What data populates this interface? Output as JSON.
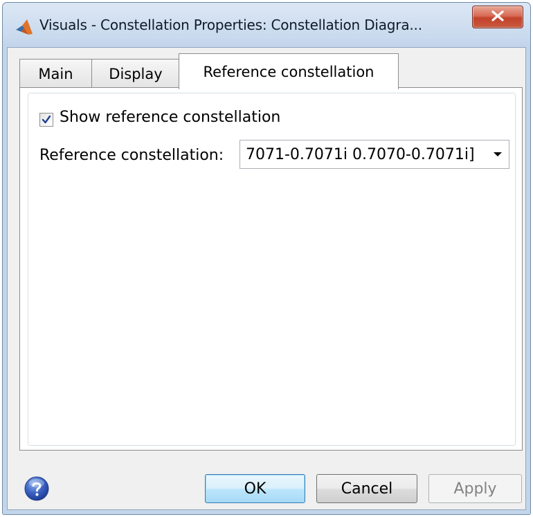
{
  "window": {
    "title": "Visuals - Constellation Properties: Constellation Diagra..."
  },
  "tabs": [
    {
      "label": "Main",
      "selected": false
    },
    {
      "label": "Display",
      "selected": false
    },
    {
      "label": "Reference constellation",
      "selected": true
    }
  ],
  "reference_tab": {
    "show_reference": {
      "label": "Show reference constellation",
      "checked": true
    },
    "constellation": {
      "label": "Reference constellation:",
      "value": "7071-0.7071i 0.7070-0.7071i]"
    }
  },
  "buttons": {
    "ok": "OK",
    "cancel": "Cancel",
    "apply": "Apply"
  },
  "icons": {
    "app": "matlab-icon",
    "close": "close-icon",
    "help": "help-icon",
    "dropdown": "chevron-down-icon"
  },
  "colors": {
    "accent": "#3c7fb1",
    "close_button": "#c2412a",
    "disabled_text": "#838383"
  }
}
